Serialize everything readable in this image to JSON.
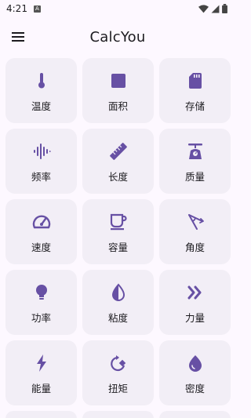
{
  "status_bar": {
    "time": "4:21",
    "notification_badge": "A"
  },
  "app_bar": {
    "title": "CalcYou",
    "menu_icon": "menu-icon"
  },
  "colors": {
    "accent": "#6750a4",
    "card_bg": "#f2eef6",
    "background": "#fdf8ff"
  },
  "categories": [
    {
      "label": "温度",
      "icon": "thermometer-icon"
    },
    {
      "label": "面积",
      "icon": "square-icon"
    },
    {
      "label": "存储",
      "icon": "sd-card-icon"
    },
    {
      "label": "频率",
      "icon": "waveform-icon"
    },
    {
      "label": "长度",
      "icon": "ruler-icon"
    },
    {
      "label": "质量",
      "icon": "scale-icon"
    },
    {
      "label": "速度",
      "icon": "speedometer-icon"
    },
    {
      "label": "容量",
      "icon": "coffee-cup-icon"
    },
    {
      "label": "角度",
      "icon": "angle-icon"
    },
    {
      "label": "功率",
      "icon": "lightbulb-icon"
    },
    {
      "label": "粘度",
      "icon": "drop-half-icon"
    },
    {
      "label": "力量",
      "icon": "double-chevron-icon"
    },
    {
      "label": "能量",
      "icon": "bolt-icon"
    },
    {
      "label": "扭矩",
      "icon": "rotate-icon"
    },
    {
      "label": "密度",
      "icon": "water-drop-icon"
    }
  ]
}
